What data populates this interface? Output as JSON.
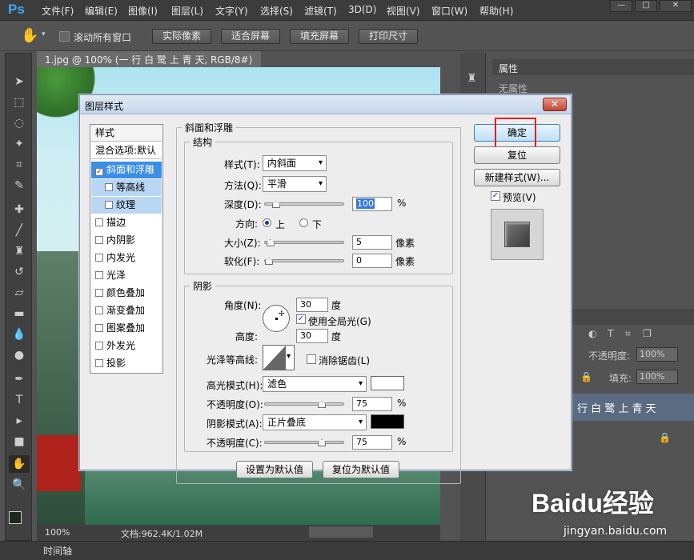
{
  "app": {
    "logo": "Ps",
    "menus": [
      "文件(F)",
      "编辑(E)",
      "图像(I)",
      "图层(L)",
      "文字(Y)",
      "选择(S)",
      "滤镜(T)",
      "3D(D)",
      "视图(V)",
      "窗口(W)",
      "帮助(H)"
    ],
    "window_controls": [
      "—",
      "□",
      "✕"
    ]
  },
  "options": {
    "scroll_all": "滚动所有窗口",
    "buttons": [
      "实际像素",
      "适合屏幕",
      "填充屏幕",
      "打印尺寸"
    ]
  },
  "document": {
    "tab_title": "1.jpg @ 100% (一 行 白 鹭 上 青 天, RGB/8#) *",
    "tab_close": "×",
    "zoom": "100%",
    "doc_info": "文档:962.4K/1.02M"
  },
  "right_panel": {
    "properties_tab": "属性",
    "properties_empty": "无属性",
    "opacity_label": "不透明度:",
    "opacity_value": "100%",
    "fill_label": "填充:",
    "fill_value": "100%",
    "layer_name": "行 白 鹭 上 青 天"
  },
  "bottom": {
    "timeline": "时间轴"
  },
  "dialog": {
    "title": "图层样式",
    "style_header": "样式",
    "blend_options": "混合选项:默认",
    "styles": [
      {
        "label": "斜面和浮雕",
        "checked": true,
        "selected": true,
        "sub": false
      },
      {
        "label": "等高线",
        "checked": false,
        "selected": false,
        "sub": true
      },
      {
        "label": "纹理",
        "checked": false,
        "selected": false,
        "sub": true
      },
      {
        "label": "描边",
        "checked": false
      },
      {
        "label": "内阴影",
        "checked": false
      },
      {
        "label": "内发光",
        "checked": false
      },
      {
        "label": "光泽",
        "checked": false
      },
      {
        "label": "颜色叠加",
        "checked": false
      },
      {
        "label": "渐变叠加",
        "checked": false
      },
      {
        "label": "图案叠加",
        "checked": false
      },
      {
        "label": "外发光",
        "checked": false
      },
      {
        "label": "投影",
        "checked": false
      }
    ],
    "bevel": {
      "group": "斜面和浮雕",
      "structure": "结构",
      "style_label": "样式(T):",
      "style_value": "内斜面",
      "technique_label": "方法(Q):",
      "technique_value": "平滑",
      "depth_label": "深度(D):",
      "depth_value": "100",
      "depth_unit": "%",
      "depth_fraction": 0.1,
      "direction_label": "方向:",
      "dir_up": "上",
      "dir_down": "下",
      "size_label": "大小(Z):",
      "size_value": "5",
      "size_unit": "像素",
      "size_fraction": 0.02,
      "soften_label": "软化(F):",
      "soften_value": "0",
      "soften_unit": "像素",
      "soften_fraction": 0.0
    },
    "shading": {
      "group": "阴影",
      "angle_label": "角度(N):",
      "angle_value": "30",
      "angle_unit": "度",
      "global_light": "使用全局光(G)",
      "global_light_checked": true,
      "altitude_label": "高度:",
      "altitude_value": "30",
      "altitude_unit": "度",
      "gloss_label": "光泽等高线:",
      "anti_alias": "消除锯齿(L)",
      "highlight_label": "高光模式(H):",
      "highlight_value": "滤色",
      "highlight_color": "#ffffff",
      "hl_opacity_label": "不透明度(O):",
      "hl_opacity_value": "75",
      "hl_opacity_unit": "%",
      "hl_opacity_fraction": 0.75,
      "shadow_label": "阴影模式(A):",
      "shadow_value": "正片叠底",
      "shadow_color": "#000000",
      "sh_opacity_label": "不透明度(C):",
      "sh_opacity_value": "75",
      "sh_opacity_unit": "%",
      "sh_opacity_fraction": 0.75
    },
    "make_default": "设置为默认值",
    "reset_default": "复位为默认值",
    "ok": "确定",
    "reset": "复位",
    "new_style": "新建样式(W)...",
    "preview": "预览(V)",
    "preview_checked": true
  },
  "watermark": {
    "brand": "Baidu经验",
    "url": "jingyan.baidu.com"
  },
  "colors": {
    "highlight_box": "#e02020",
    "accent": "#3fa9f5"
  }
}
